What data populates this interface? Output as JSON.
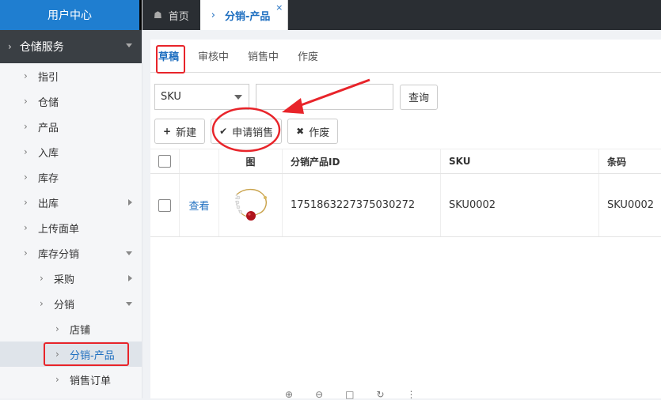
{
  "sidebar": {
    "header": "用户中心",
    "group": "仓储服务",
    "items": [
      {
        "label": "指引"
      },
      {
        "label": "仓储"
      },
      {
        "label": "产品"
      },
      {
        "label": "入库"
      },
      {
        "label": "库存"
      },
      {
        "label": "出库"
      },
      {
        "label": "上传面单"
      },
      {
        "label": "库存分销"
      },
      {
        "label": "采购"
      },
      {
        "label": "分销"
      },
      {
        "label": "店铺"
      },
      {
        "label": "分销-产品"
      },
      {
        "label": "销售订单"
      }
    ]
  },
  "topbar": {
    "home_tab": "首页",
    "active_tab": "分销-产品",
    "close": "×"
  },
  "subtabs": [
    "草稿",
    "审核中",
    "销售中",
    "作废"
  ],
  "filter": {
    "select_value": "SKU",
    "query_label": "查询"
  },
  "actions": {
    "new_label": "新建",
    "apply_label": "申请销售",
    "void_label": "作废"
  },
  "table": {
    "headers": [
      "图",
      "分销产品ID",
      "SKU",
      "条码"
    ],
    "rows": [
      {
        "view": "查看",
        "id": "1751863227375030272",
        "sku": "SKU0002",
        "barcode": "SKU0002"
      }
    ]
  },
  "colors": {
    "accent": "#1f6fc0",
    "annotation": "#e8242a",
    "header_blue": "#1f7ed0"
  }
}
